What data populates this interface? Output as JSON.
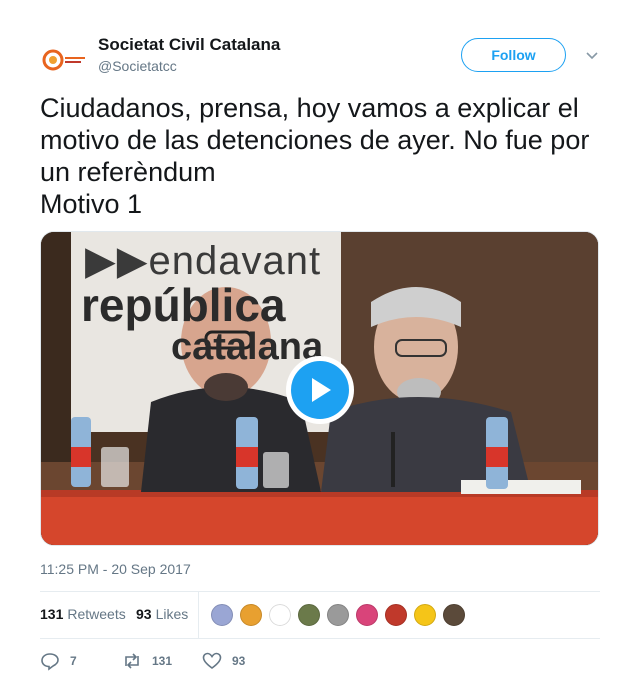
{
  "tweet": {
    "author": {
      "name": "Societat Civil Catalana",
      "handle": "@Societatcc",
      "avatar_icon": "scc-logo-icon"
    },
    "follow_label": "Follow",
    "text": "Ciudadanos, prensa, hoy vamos a explicar el motivo de las detenciones de ayer. No fue por un referèndum\nMotivo 1",
    "media": {
      "type": "video",
      "banner": {
        "line1": "▶▶endavant",
        "line2": "república",
        "line3": "catalana"
      },
      "play_icon": "play-icon"
    },
    "timestamp": "11:25 PM - 20 Sep 2017",
    "stats": {
      "retweets": {
        "count": "131",
        "label": "Retweets"
      },
      "likes": {
        "count": "93",
        "label": "Likes"
      }
    },
    "likers": [
      {
        "name": "liker-avatar-1",
        "color": "#9aa6d4"
      },
      {
        "name": "liker-avatar-2",
        "color": "#e8a030"
      },
      {
        "name": "liker-avatar-3",
        "color": "#ffffff"
      },
      {
        "name": "liker-avatar-4",
        "color": "#6b7a4a"
      },
      {
        "name": "liker-avatar-5",
        "color": "#9a9a9a"
      },
      {
        "name": "liker-avatar-6",
        "color": "#d9447a"
      },
      {
        "name": "liker-avatar-7",
        "color": "#c0392b"
      },
      {
        "name": "liker-avatar-8",
        "color": "#f5c518"
      },
      {
        "name": "liker-avatar-9",
        "color": "#5b4a3a"
      }
    ],
    "actions": {
      "reply": {
        "icon": "reply-icon",
        "count": "7"
      },
      "retweet": {
        "icon": "retweet-icon",
        "count": "131"
      },
      "like": {
        "icon": "heart-icon",
        "count": "93"
      }
    },
    "colors": {
      "accent": "#1da1f2",
      "muted": "#657786",
      "text": "#14171a",
      "border": "#e6ecf0"
    }
  }
}
